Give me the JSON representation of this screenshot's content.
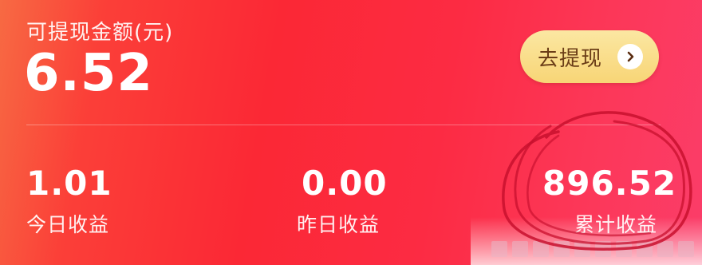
{
  "balance": {
    "label": "可提现金额(元)",
    "amount": "6.52"
  },
  "withdraw": {
    "label": "去提现",
    "icon": "chevron-right-icon"
  },
  "stats": [
    {
      "value": "1.01",
      "label": "今日收益"
    },
    {
      "value": "0.00",
      "label": "昨日收益"
    },
    {
      "value": "896.52",
      "label": "累计收益"
    }
  ],
  "colors": {
    "background_start": "#f76a43",
    "background_mid": "#fb2835",
    "background_end": "#fb3d69",
    "button": "#f8d576",
    "button_text": "#6b3d17",
    "annotation_circle": "#c8102e"
  }
}
